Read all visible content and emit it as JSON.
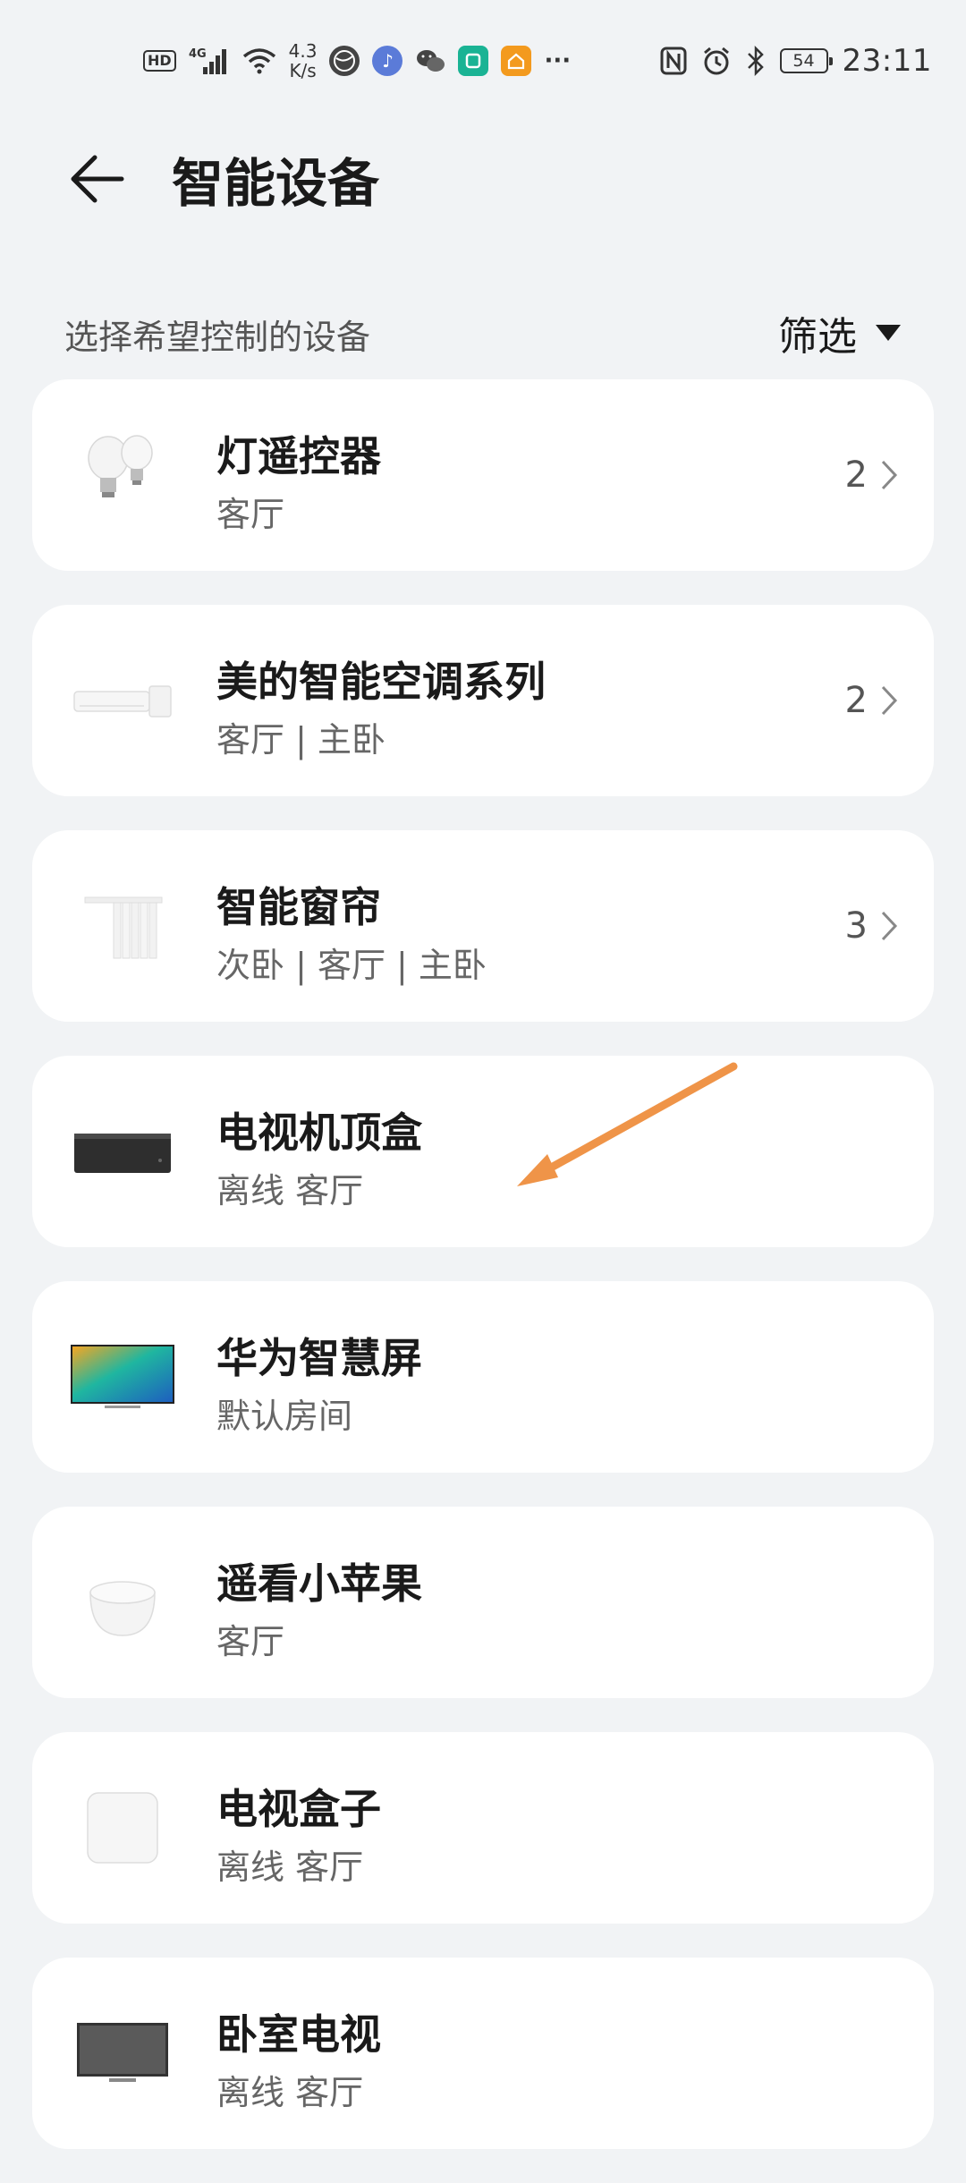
{
  "status_bar": {
    "hd": "HD",
    "signal": "4G",
    "net_speed_value": "4.3",
    "net_speed_unit": "K/s",
    "more": "···",
    "battery": "54",
    "time": "23:11"
  },
  "header": {
    "title": "智能设备"
  },
  "section": {
    "label": "选择希望控制的设备",
    "filter_label": "筛选"
  },
  "devices": [
    {
      "name": "灯遥控器",
      "sub": "客厅",
      "count": "2",
      "icon": "light-bulb-icon"
    },
    {
      "name": "美的智能空调系列",
      "sub": "客厅 | 主卧",
      "count": "2",
      "icon": "air-conditioner-icon"
    },
    {
      "name": "智能窗帘",
      "sub": "次卧 | 客厅 | 主卧",
      "count": "3",
      "icon": "curtain-icon"
    },
    {
      "name": "电视机顶盒",
      "sub": "离线 客厅",
      "count": "",
      "icon": "set-top-box-icon"
    },
    {
      "name": "华为智慧屏",
      "sub": "默认房间",
      "count": "",
      "icon": "smart-screen-icon"
    },
    {
      "name": "遥看小苹果",
      "sub": "客厅",
      "count": "",
      "icon": "speaker-icon"
    },
    {
      "name": "电视盒子",
      "sub": "离线 客厅",
      "count": "",
      "icon": "tv-box-icon"
    },
    {
      "name": "卧室电视",
      "sub": "离线 客厅",
      "count": "",
      "icon": "tv-icon"
    }
  ],
  "colors": {
    "background": "#f1f3f5",
    "card": "#ffffff",
    "annotation_arrow": "#ef9448"
  }
}
